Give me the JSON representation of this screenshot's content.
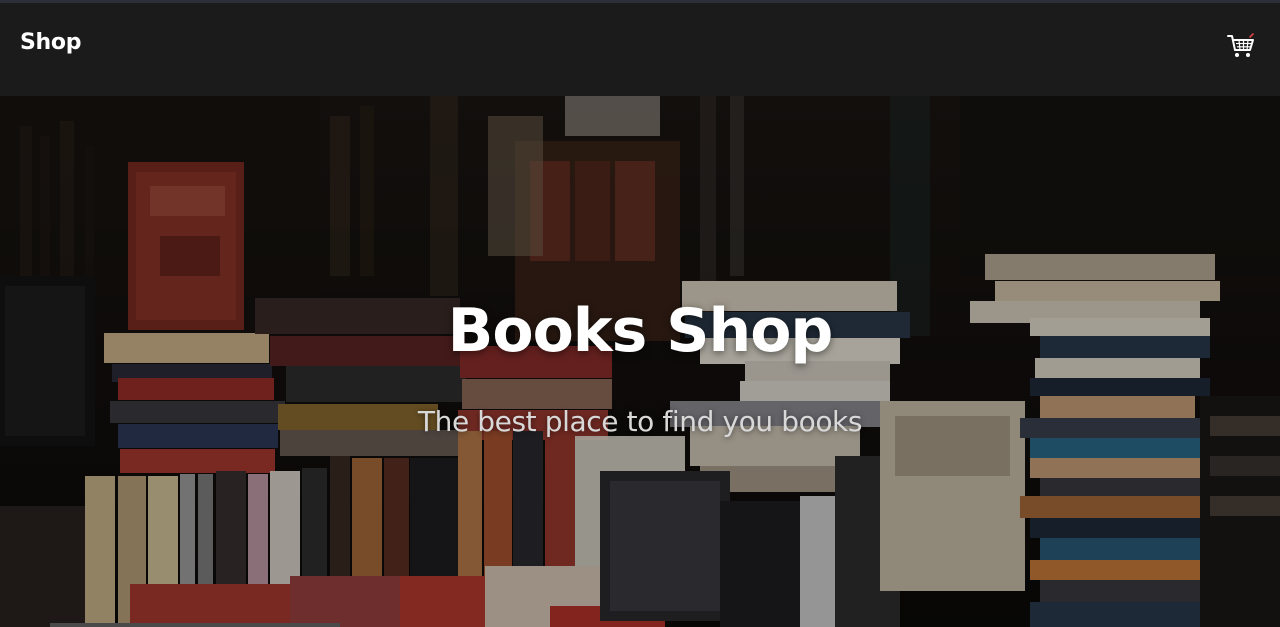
{
  "navbar": {
    "brand": "Shop",
    "cart_icon": "shopping-cart-icon"
  },
  "hero": {
    "title": "Books Shop",
    "subtitle": "The best place to find you books",
    "background": "bookstore-piles-photo"
  },
  "colors": {
    "navbar_bg": "#1b1b1b",
    "title": "#ffffff",
    "subtitle": "#d8d8d8"
  }
}
